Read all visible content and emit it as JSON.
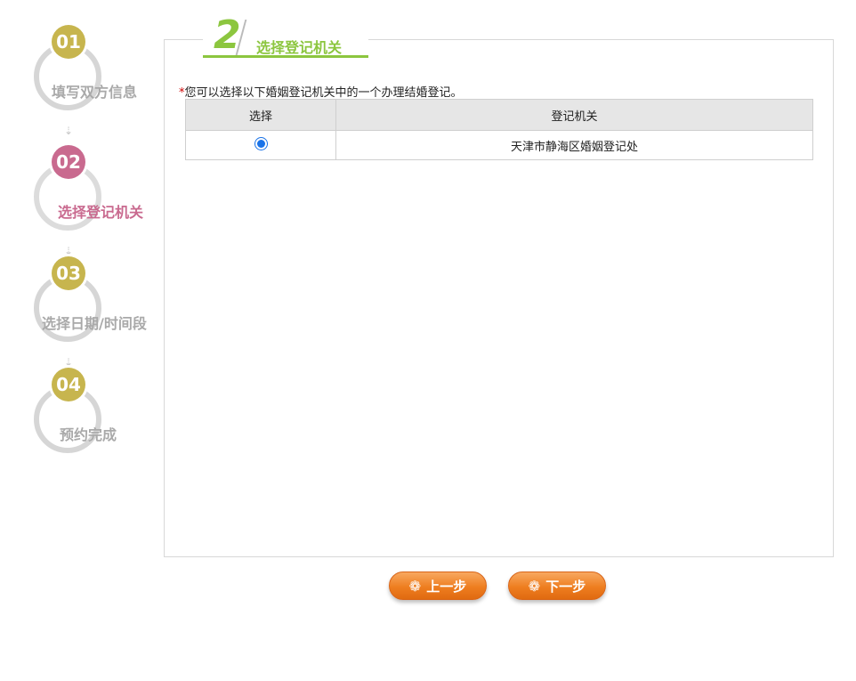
{
  "steps": [
    {
      "num": "01",
      "label": "填写双方信息",
      "active": false
    },
    {
      "num": "02",
      "label": "选择登记机关",
      "active": true
    },
    {
      "num": "03",
      "label": "选择日期/时间段",
      "active": false
    },
    {
      "num": "04",
      "label": "预约完成",
      "active": false
    }
  ],
  "tab": {
    "number": "2",
    "title": "选择登记机关"
  },
  "notice": {
    "star": "*",
    "text": "您可以选择以下婚姻登记机关中的一个办理结婚登记。"
  },
  "table": {
    "headers": [
      "选择",
      "登记机关"
    ],
    "rows": [
      {
        "selected": true,
        "office": "天津市静海区婚姻登记处"
      }
    ]
  },
  "buttons": {
    "prev": "上一步",
    "next": "下一步"
  },
  "colors": {
    "accent_green": "#8cc63f",
    "active_pink": "#c96a8f",
    "step_gold": "#c7b54e",
    "button_orange": "#ee7e20"
  }
}
